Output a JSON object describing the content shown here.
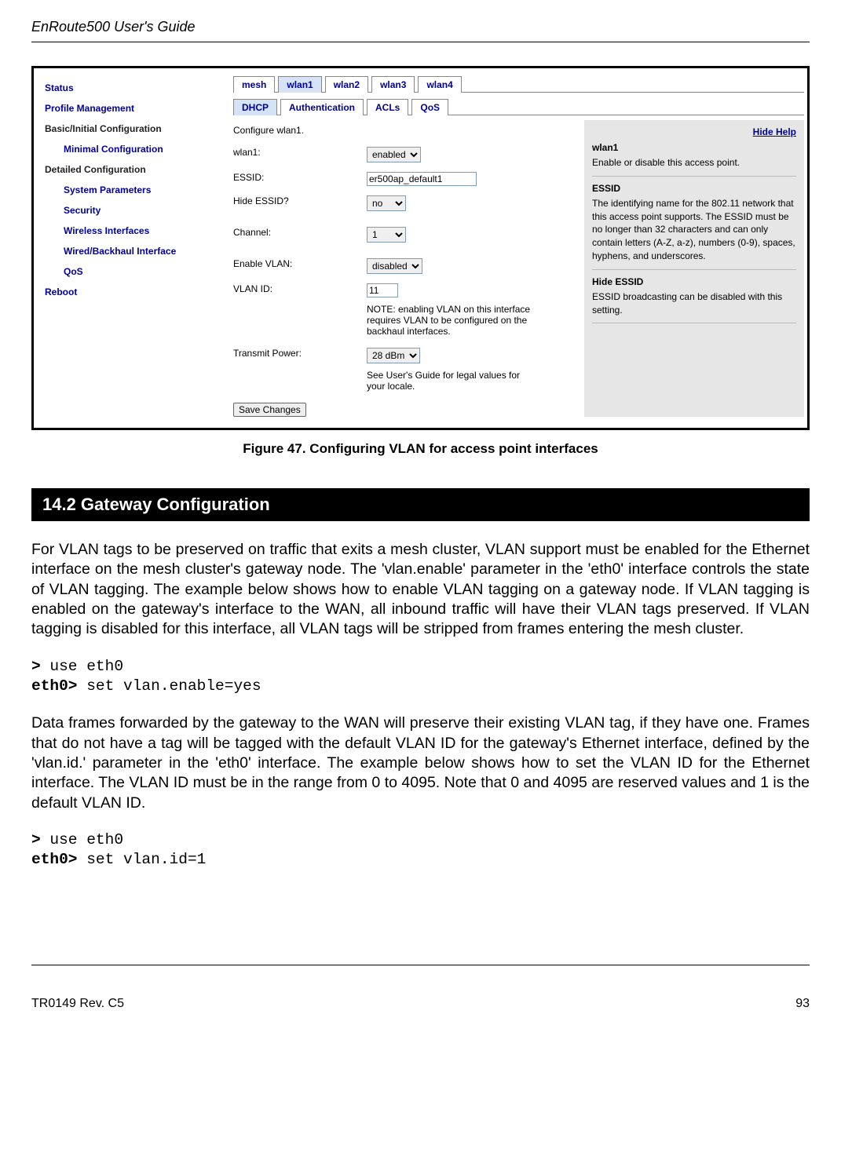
{
  "header": {
    "title": "EnRoute500 User's Guide"
  },
  "sidebar": {
    "status": "Status",
    "profile_mgmt": "Profile Management",
    "basic_heading": "Basic/Initial Configuration",
    "minimal_config": "Minimal Configuration",
    "detailed_heading": "Detailed Configuration",
    "system_params": "System Parameters",
    "security": "Security",
    "wireless_if": "Wireless Interfaces",
    "wired_if": "Wired/Backhaul Interface",
    "qos": "QoS",
    "reboot": "Reboot"
  },
  "tabs": {
    "mesh": "mesh",
    "wlan1": "wlan1",
    "wlan2": "wlan2",
    "wlan3": "wlan3",
    "wlan4": "wlan4"
  },
  "subtabs": {
    "dhcp": "DHCP",
    "auth": "Authentication",
    "acls": "ACLs",
    "qos": "QoS"
  },
  "form": {
    "configure_line": "Configure wlan1.",
    "wlan1_label": "wlan1:",
    "wlan1_value": "enabled",
    "essid_label": "ESSID:",
    "essid_value": "er500ap_default1",
    "hide_essid_label": "Hide ESSID?",
    "hide_essid_value": "no",
    "channel_label": "Channel:",
    "channel_value": "1",
    "enable_vlan_label": "Enable VLAN:",
    "enable_vlan_value": "disabled",
    "vlan_id_label": "VLAN ID:",
    "vlan_id_value": "11",
    "vlan_note": "NOTE: enabling VLAN on this interface requires VLAN to be configured on the backhaul interfaces.",
    "tx_power_label": "Transmit Power:",
    "tx_power_value": "28 dBm",
    "tx_power_note": "See User's Guide for legal values for your locale.",
    "save_btn": "Save Changes"
  },
  "help": {
    "hide_link": "Hide Help",
    "wlan1_title": "wlan1",
    "wlan1_text": "Enable or disable this access point.",
    "essid_title": "ESSID",
    "essid_text": "The identifying name for the 802.11 network that this access point supports. The ESSID must be no longer than 32 characters and can only contain letters (A-Z, a-z), numbers (0-9), spaces, hyphens, and underscores.",
    "hide_essid_title": "Hide ESSID",
    "hide_essid_text": "ESSID broadcasting can be disabled with this setting."
  },
  "figure_caption": "Figure 47. Configuring VLAN for access point interfaces",
  "section_header": "14.2    Gateway Configuration",
  "para1": "For VLAN tags to be preserved on traffic that exits a mesh cluster, VLAN support must be enabled for the Ethernet interface on the mesh cluster's gateway node. The 'vlan.enable' parameter in the 'eth0' interface controls the state of VLAN tagging. The example below shows how to enable VLAN tagging on a gateway node. If VLAN tagging is enabled on the gateway's interface to the WAN, all inbound traffic will have their VLAN tags preserved. If VLAN tagging is disabled for this interface, all VLAN tags will be stripped from frames entering the mesh cluster.",
  "cli1_prompt1": ">",
  "cli1_cmd1": " use eth0",
  "cli1_prompt2": "eth0>",
  "cli1_cmd2": " set vlan.enable=yes",
  "para2": "Data frames forwarded by the gateway to the WAN will preserve their existing VLAN tag, if they have one. Frames that do not have a tag will be tagged with the default VLAN ID for the gateway's Ethernet interface, defined by the 'vlan.id.' parameter in the 'eth0' interface. The example below shows how to set the VLAN ID for the Ethernet interface. The VLAN ID must be in the range from 0 to 4095. Note that 0 and 4095 are reserved values and 1 is the default VLAN ID.",
  "cli2_prompt1": ">",
  "cli2_cmd1": " use eth0",
  "cli2_prompt2": "eth0>",
  "cli2_cmd2": " set vlan.id=1",
  "footer": {
    "left": "TR0149 Rev. C5",
    "right": "93"
  }
}
